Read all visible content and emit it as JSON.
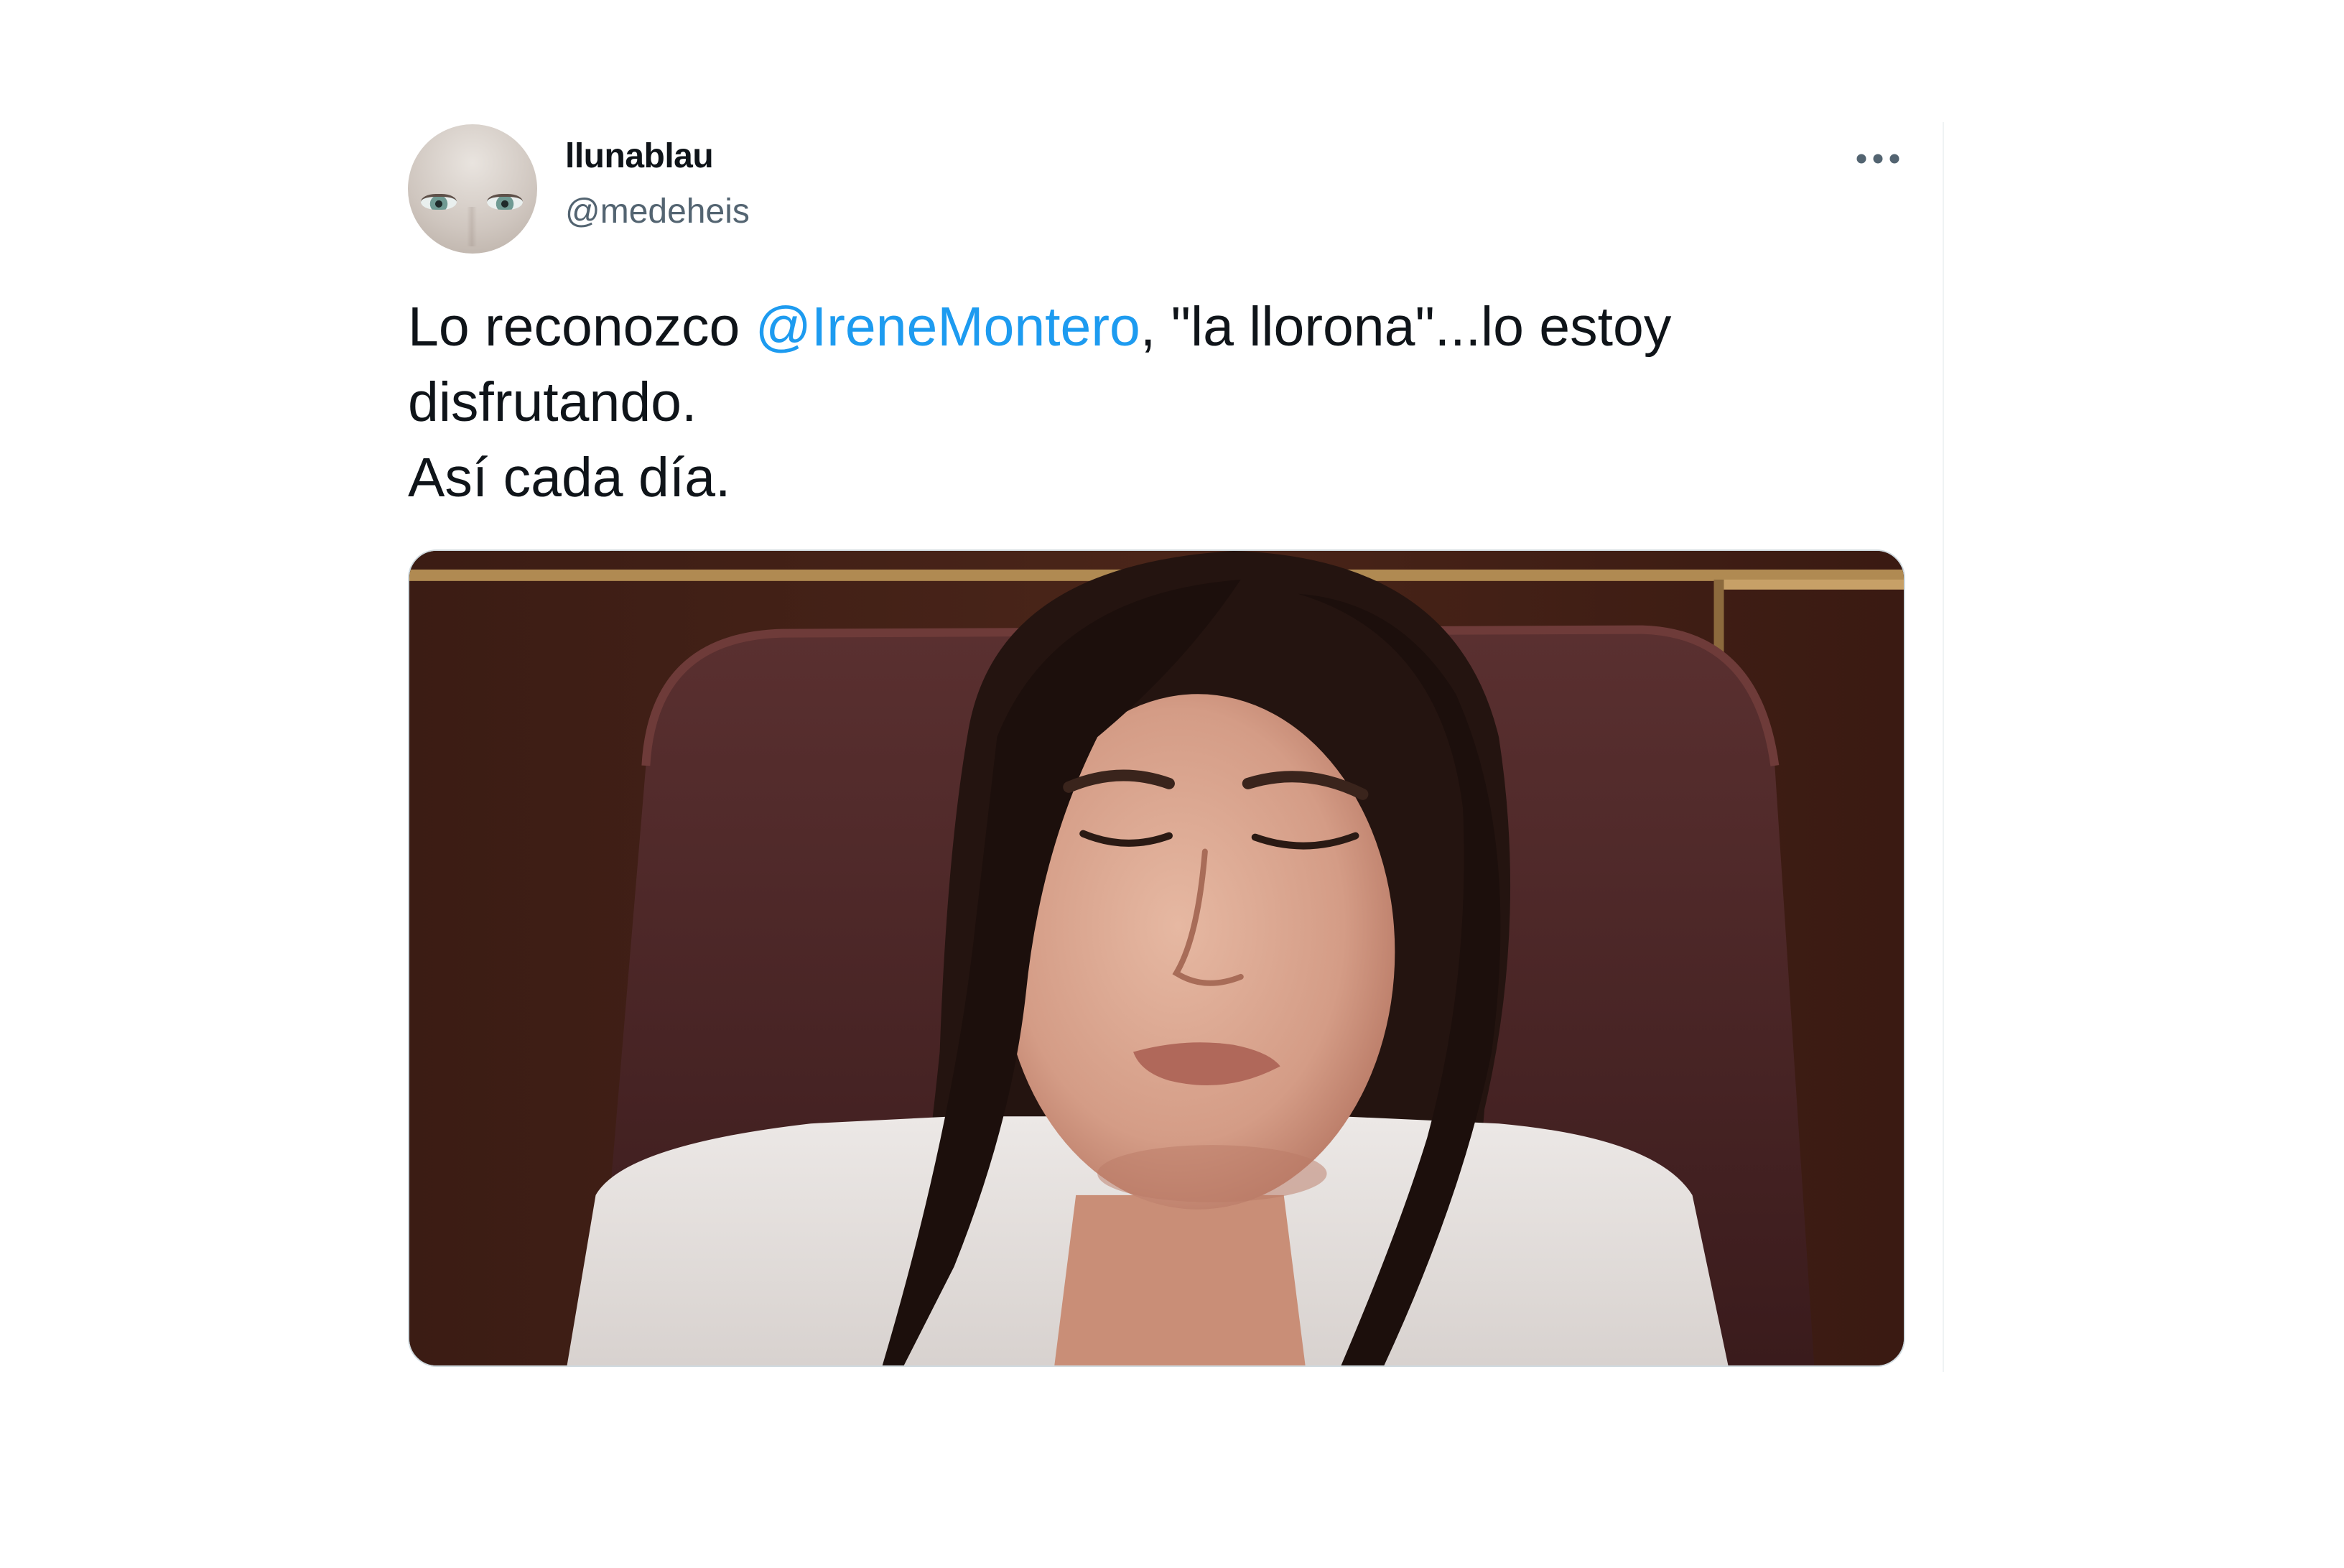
{
  "tweet": {
    "author": {
      "display_name": "llunablau",
      "handle": "@medeheis",
      "avatar_icon": "avatar-photo"
    },
    "menu_icon": "more-horizontal-icon",
    "text": {
      "line1_prefix": "Lo reconozco ",
      "mention": "@IreneMontero",
      "line1_suffix": ", \"la llorona\"...lo estoy",
      "line2": "disfrutando.",
      "line3": "Así cada día."
    },
    "media": {
      "type": "photo",
      "icon": "photo-image"
    }
  },
  "colors": {
    "text": "#0f1419",
    "secondary_text": "#536471",
    "mention": "#1d9bf0",
    "border": "#cfd9de"
  }
}
